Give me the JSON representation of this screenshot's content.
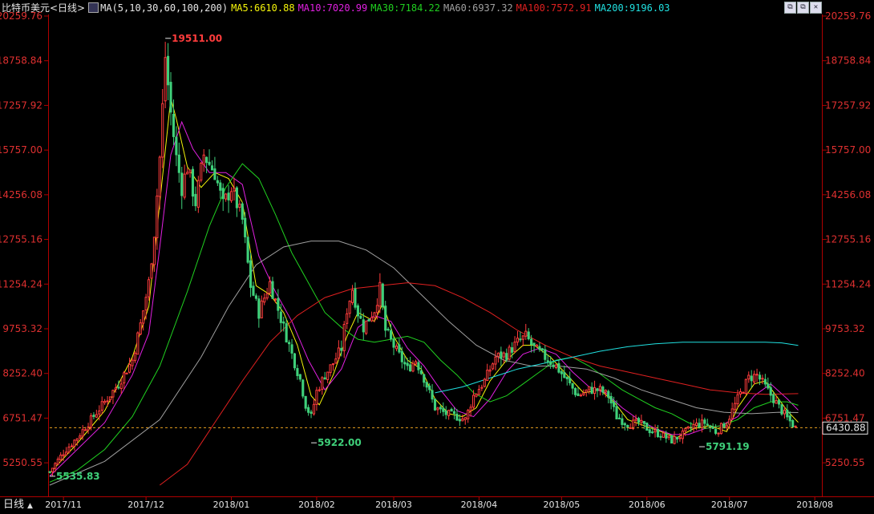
{
  "header": {
    "title": "比特币美元<日线>",
    "ma_icon": "chart-settings-icon",
    "ma_params": "MA(5,10,30,60,100,200)",
    "ma5": "MA5:6610.88",
    "ma10": "MA10:7020.99",
    "ma30": "MA30:7184.22",
    "ma60": "MA60:6937.32",
    "ma100": "MA100:7572.91",
    "ma200": "MA200:9196.03",
    "window_icons": [
      "window-restore-icon",
      "window-restore-icon",
      "close-icon"
    ]
  },
  "bottom_tab": {
    "label": "日线",
    "arrow": "▲"
  },
  "chart_data": {
    "type": "candlestick",
    "title": "比特币美元<日线>",
    "ylim": [
      4500,
      20259.76
    ],
    "y_ticks": [
      20259.76,
      18758.84,
      17257.92,
      15757.0,
      14256.08,
      12755.16,
      11254.24,
      9753.32,
      8252.4,
      6751.47,
      5250.55
    ],
    "x_ticks": [
      {
        "label": "2017/11",
        "day": 5
      },
      {
        "label": "2017/12",
        "day": 35
      },
      {
        "label": "2018/01",
        "day": 66
      },
      {
        "label": "2018/02",
        "day": 97
      },
      {
        "label": "2018/03",
        "day": 125
      },
      {
        "label": "2018/04",
        "day": 156
      },
      {
        "label": "2018/05",
        "day": 186
      },
      {
        "label": "2018/06",
        "day": 217
      },
      {
        "label": "2018/07",
        "day": 247
      },
      {
        "label": "2018/08",
        "day": 278
      }
    ],
    "current_price": "6430.88",
    "current_value": 6430.88,
    "annotations": [
      {
        "text": "19511.00",
        "day": 42,
        "value": 19511.0,
        "kind": "high"
      },
      {
        "text": "5922.00",
        "day": 95,
        "value": 5922.0,
        "kind": "low"
      },
      {
        "text": "5791.19",
        "day": 236,
        "value": 5791.19,
        "kind": "low"
      },
      {
        "text": "5535.83",
        "day": 0,
        "value": 4800,
        "kind": "low"
      }
    ],
    "close_path": [
      [
        0,
        4950
      ],
      [
        5,
        5600
      ],
      [
        10,
        6100
      ],
      [
        15,
        6700
      ],
      [
        20,
        7300
      ],
      [
        25,
        7900
      ],
      [
        30,
        8700
      ],
      [
        33,
        9900
      ],
      [
        36,
        11300
      ],
      [
        38,
        13000
      ],
      [
        40,
        15500
      ],
      [
        42,
        18900
      ],
      [
        44,
        17000
      ],
      [
        46,
        15500
      ],
      [
        48,
        14500
      ],
      [
        50,
        15200
      ],
      [
        53,
        14000
      ],
      [
        56,
        15600
      ],
      [
        60,
        15000
      ],
      [
        63,
        13900
      ],
      [
        66,
        14500
      ],
      [
        70,
        13400
      ],
      [
        73,
        11200
      ],
      [
        76,
        10300
      ],
      [
        80,
        11300
      ],
      [
        84,
        10100
      ],
      [
        88,
        8900
      ],
      [
        91,
        8050
      ],
      [
        93,
        7200
      ],
      [
        95,
        6800
      ],
      [
        97,
        7650
      ],
      [
        100,
        8200
      ],
      [
        103,
        8600
      ],
      [
        106,
        9100
      ],
      [
        108,
        10400
      ],
      [
        110,
        11100
      ],
      [
        112,
        10300
      ],
      [
        114,
        9800
      ],
      [
        118,
        10400
      ],
      [
        120,
        11100
      ],
      [
        122,
        9700
      ],
      [
        126,
        9000
      ],
      [
        130,
        8400
      ],
      [
        133,
        8700
      ],
      [
        136,
        8100
      ],
      [
        140,
        7100
      ],
      [
        144,
        6900
      ],
      [
        148,
        6800
      ],
      [
        151,
        6700
      ],
      [
        154,
        7500
      ],
      [
        158,
        8000
      ],
      [
        162,
        8800
      ],
      [
        166,
        8900
      ],
      [
        170,
        9300
      ],
      [
        173,
        9500
      ],
      [
        176,
        9100
      ],
      [
        180,
        8800
      ],
      [
        184,
        8500
      ],
      [
        188,
        8000
      ],
      [
        192,
        7500
      ],
      [
        196,
        7700
      ],
      [
        200,
        7700
      ],
      [
        203,
        7500
      ],
      [
        206,
        6800
      ],
      [
        210,
        6550
      ],
      [
        214,
        6600
      ],
      [
        218,
        6350
      ],
      [
        222,
        6200
      ],
      [
        226,
        6000
      ],
      [
        230,
        6200
      ],
      [
        234,
        6500
      ],
      [
        238,
        6600
      ],
      [
        242,
        6300
      ],
      [
        246,
        6600
      ],
      [
        250,
        7400
      ],
      [
        254,
        8100
      ],
      [
        257,
        8200
      ],
      [
        260,
        7800
      ],
      [
        263,
        7400
      ],
      [
        266,
        7000
      ],
      [
        268,
        6750
      ],
      [
        271,
        6430
      ]
    ],
    "series": [
      {
        "name": "MA5",
        "color": "#f5f50a",
        "values": [
          [
            0,
            4900
          ],
          [
            10,
            5900
          ],
          [
            20,
            7000
          ],
          [
            30,
            8800
          ],
          [
            36,
            10500
          ],
          [
            40,
            14000
          ],
          [
            44,
            17500
          ],
          [
            46,
            16800
          ],
          [
            50,
            15200
          ],
          [
            55,
            14500
          ],
          [
            60,
            15000
          ],
          [
            65,
            14800
          ],
          [
            70,
            14000
          ],
          [
            75,
            11200
          ],
          [
            80,
            10900
          ],
          [
            85,
            10300
          ],
          [
            90,
            9200
          ],
          [
            95,
            7500
          ],
          [
            98,
            7200
          ],
          [
            103,
            8200
          ],
          [
            108,
            9500
          ],
          [
            112,
            10300
          ],
          [
            118,
            10000
          ],
          [
            121,
            10600
          ],
          [
            125,
            9500
          ],
          [
            130,
            8700
          ],
          [
            135,
            8400
          ],
          [
            140,
            7400
          ],
          [
            145,
            6900
          ],
          [
            150,
            6800
          ],
          [
            155,
            7100
          ],
          [
            160,
            8000
          ],
          [
            166,
            8700
          ],
          [
            172,
            9200
          ],
          [
            176,
            9200
          ],
          [
            182,
            8800
          ],
          [
            188,
            8200
          ],
          [
            194,
            7600
          ],
          [
            200,
            7700
          ],
          [
            205,
            7300
          ],
          [
            210,
            6700
          ],
          [
            216,
            6500
          ],
          [
            222,
            6300
          ],
          [
            228,
            6100
          ],
          [
            234,
            6400
          ],
          [
            240,
            6500
          ],
          [
            246,
            6300
          ],
          [
            250,
            7100
          ],
          [
            256,
            7900
          ],
          [
            260,
            8000
          ],
          [
            264,
            7500
          ],
          [
            268,
            7000
          ],
          [
            272,
            6610
          ]
        ]
      },
      {
        "name": "MA10",
        "color": "#e020e0",
        "values": [
          [
            0,
            4800
          ],
          [
            10,
            5700
          ],
          [
            20,
            6600
          ],
          [
            30,
            8200
          ],
          [
            36,
            9600
          ],
          [
            40,
            12500
          ],
          [
            44,
            15600
          ],
          [
            48,
            16700
          ],
          [
            52,
            15800
          ],
          [
            58,
            15000
          ],
          [
            64,
            15000
          ],
          [
            70,
            14600
          ],
          [
            76,
            12200
          ],
          [
            82,
            11000
          ],
          [
            88,
            10000
          ],
          [
            94,
            8700
          ],
          [
            100,
            7700
          ],
          [
            106,
            8400
          ],
          [
            112,
            9800
          ],
          [
            118,
            10200
          ],
          [
            124,
            10000
          ],
          [
            130,
            9100
          ],
          [
            136,
            8500
          ],
          [
            142,
            7700
          ],
          [
            148,
            7000
          ],
          [
            154,
            6800
          ],
          [
            160,
            7400
          ],
          [
            166,
            8300
          ],
          [
            172,
            8900
          ],
          [
            178,
            9100
          ],
          [
            184,
            8900
          ],
          [
            190,
            8300
          ],
          [
            196,
            7800
          ],
          [
            202,
            7600
          ],
          [
            208,
            7100
          ],
          [
            214,
            6700
          ],
          [
            220,
            6400
          ],
          [
            226,
            6200
          ],
          [
            232,
            6200
          ],
          [
            238,
            6400
          ],
          [
            244,
            6500
          ],
          [
            250,
            6800
          ],
          [
            256,
            7500
          ],
          [
            262,
            7900
          ],
          [
            268,
            7400
          ],
          [
            272,
            7020
          ]
        ]
      },
      {
        "name": "MA30",
        "color": "#20d020",
        "values": [
          [
            0,
            4600
          ],
          [
            10,
            5000
          ],
          [
            20,
            5700
          ],
          [
            30,
            6800
          ],
          [
            40,
            8500
          ],
          [
            50,
            11000
          ],
          [
            58,
            13200
          ],
          [
            64,
            14500
          ],
          [
            70,
            15300
          ],
          [
            76,
            14800
          ],
          [
            82,
            13600
          ],
          [
            88,
            12300
          ],
          [
            94,
            11300
          ],
          [
            100,
            10300
          ],
          [
            106,
            9800
          ],
          [
            112,
            9400
          ],
          [
            118,
            9300
          ],
          [
            124,
            9400
          ],
          [
            130,
            9500
          ],
          [
            136,
            9300
          ],
          [
            142,
            8700
          ],
          [
            148,
            8200
          ],
          [
            154,
            7600
          ],
          [
            160,
            7300
          ],
          [
            166,
            7500
          ],
          [
            172,
            7900
          ],
          [
            178,
            8300
          ],
          [
            184,
            8700
          ],
          [
            190,
            8800
          ],
          [
            196,
            8500
          ],
          [
            202,
            8100
          ],
          [
            208,
            7700
          ],
          [
            214,
            7400
          ],
          [
            220,
            7100
          ],
          [
            226,
            6900
          ],
          [
            232,
            6600
          ],
          [
            238,
            6400
          ],
          [
            244,
            6500
          ],
          [
            250,
            6700
          ],
          [
            256,
            7100
          ],
          [
            262,
            7300
          ],
          [
            268,
            7300
          ],
          [
            272,
            7184
          ]
        ]
      },
      {
        "name": "MA60",
        "color": "#a0a0a0",
        "values": [
          [
            0,
            4500
          ],
          [
            20,
            5300
          ],
          [
            40,
            6700
          ],
          [
            55,
            8800
          ],
          [
            65,
            10500
          ],
          [
            75,
            11900
          ],
          [
            85,
            12500
          ],
          [
            95,
            12700
          ],
          [
            105,
            12700
          ],
          [
            115,
            12400
          ],
          [
            125,
            11800
          ],
          [
            135,
            10900
          ],
          [
            145,
            10000
          ],
          [
            155,
            9200
          ],
          [
            165,
            8700
          ],
          [
            175,
            8500
          ],
          [
            185,
            8500
          ],
          [
            195,
            8400
          ],
          [
            205,
            8100
          ],
          [
            215,
            7700
          ],
          [
            225,
            7400
          ],
          [
            235,
            7100
          ],
          [
            245,
            6950
          ],
          [
            255,
            6900
          ],
          [
            265,
            6950
          ],
          [
            272,
            6937
          ]
        ]
      },
      {
        "name": "MA100",
        "color": "#e02020",
        "values": [
          [
            40,
            4500
          ],
          [
            50,
            5200
          ],
          [
            60,
            6600
          ],
          [
            70,
            8000
          ],
          [
            80,
            9300
          ],
          [
            90,
            10200
          ],
          [
            100,
            10800
          ],
          [
            110,
            11100
          ],
          [
            120,
            11200
          ],
          [
            130,
            11300
          ],
          [
            140,
            11200
          ],
          [
            150,
            10800
          ],
          [
            160,
            10300
          ],
          [
            170,
            9700
          ],
          [
            180,
            9200
          ],
          [
            190,
            8800
          ],
          [
            200,
            8500
          ],
          [
            210,
            8300
          ],
          [
            220,
            8100
          ],
          [
            230,
            7900
          ],
          [
            240,
            7700
          ],
          [
            250,
            7600
          ],
          [
            260,
            7550
          ],
          [
            272,
            7573
          ]
        ]
      },
      {
        "name": "MA200",
        "color": "#20e0e0",
        "values": [
          [
            140,
            7600
          ],
          [
            150,
            7800
          ],
          [
            160,
            8100
          ],
          [
            170,
            8400
          ],
          [
            180,
            8600
          ],
          [
            190,
            8800
          ],
          [
            200,
            9000
          ],
          [
            210,
            9150
          ],
          [
            220,
            9250
          ],
          [
            230,
            9300
          ],
          [
            240,
            9300
          ],
          [
            250,
            9300
          ],
          [
            260,
            9300
          ],
          [
            266,
            9280
          ],
          [
            272,
            9196
          ]
        ]
      }
    ]
  }
}
